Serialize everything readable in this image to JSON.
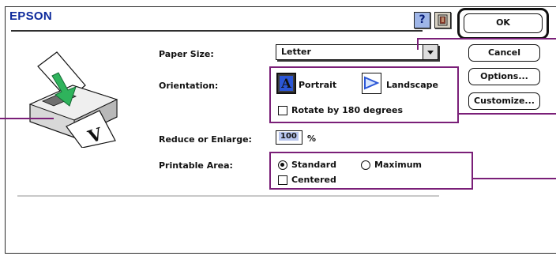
{
  "dialog": {
    "brand": "EPSON",
    "help_label": "?"
  },
  "buttons": {
    "ok": "OK",
    "cancel": "Cancel",
    "options": "Options...",
    "customize": "Customize..."
  },
  "paper_size": {
    "label": "Paper Size:",
    "value": "Letter"
  },
  "orientation": {
    "label": "Orientation:",
    "portrait_label": "Portrait",
    "portrait_glyph": "A",
    "landscape_label": "Landscape",
    "selected": "Portrait",
    "rotate_label": "Rotate by 180 degrees",
    "rotate_checked": false
  },
  "reduce_enlarge": {
    "label": "Reduce or Enlarge:",
    "value": "100",
    "unit": "%"
  },
  "printable_area": {
    "label": "Printable Area:",
    "standard_label": "Standard",
    "maximum_label": "Maximum",
    "selected": "Standard",
    "centered_label": "Centered",
    "centered_checked": false
  },
  "preview": {
    "glyph": "V"
  },
  "colors": {
    "brand": "#0d2a9c",
    "callout": "#7a1f78",
    "field_highlight": "#b8c6ee",
    "printer_accent": "#2fb35c"
  }
}
